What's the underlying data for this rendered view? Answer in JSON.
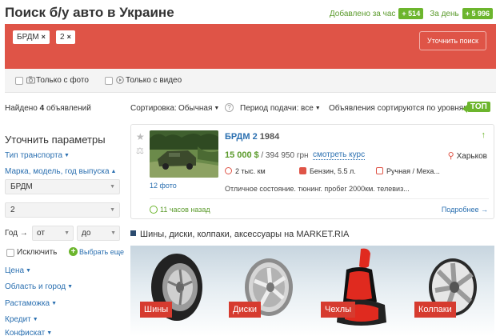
{
  "header": {
    "title": "Поиск б/у авто в Украине",
    "added_hour_label": "Добавлено за час",
    "added_hour_count": "+ 514",
    "added_day_label": "За день",
    "added_day_count": "+ 5 996"
  },
  "search": {
    "chips": [
      {
        "label": "БРДМ",
        "remove": "×"
      },
      {
        "label": "2",
        "remove": "×"
      }
    ],
    "refine_button": "Уточнить поиск",
    "only_photo": "Только с фото",
    "only_video": "Только с видео"
  },
  "results": {
    "found_prefix": "Найдено",
    "found_count": "4",
    "found_suffix": "объявлений"
  },
  "sort": {
    "sort_label": "Сортировка:",
    "sort_value": "Обычная",
    "period_label": "Период подачи:",
    "period_value": "все",
    "top_note": "Объявления сортируются по уровням",
    "top_badge": "ТОП"
  },
  "sidebar": {
    "title": "Уточнить параметры",
    "transport_type": "Тип транспорта",
    "make_model": "Марка, модель, год выпуска",
    "make_value": "БРДМ",
    "model_value": "2",
    "year_label": "Год →",
    "year_from": "от",
    "year_to": "до",
    "exclude": "Исключить",
    "choose_more": "Выбрать еще",
    "links": [
      "Цена",
      "Область и город",
      "Растаможка",
      "Кредит",
      "Конфискат"
    ]
  },
  "listing": {
    "title": "БРДМ 2",
    "year": "1984",
    "price_usd": "15 000",
    "price_usd_unit": "$",
    "price_uah": "/ 394 950 грн",
    "course_link": "смотреть курс",
    "city": "Харьков",
    "photos": "12 фото",
    "mileage": "2 тыс. км",
    "fuel": "Бензин, 5.5 л.",
    "gearbox": "Ручная / Меха...",
    "description": "Отличное состояние. тюнинг. пробег 2000км. телевиз...",
    "time_ago": "11 часов назад",
    "more": "Подробнее →"
  },
  "ads": {
    "title": "Шины, диски, колпаки, аксессуары на MARKET.RIA",
    "items": [
      "Шины",
      "Диски",
      "Чехлы",
      "Колпаки"
    ]
  },
  "colors": {
    "accent_red": "#df5447",
    "link_blue": "#2a6fb0",
    "green": "#6cb52d"
  }
}
